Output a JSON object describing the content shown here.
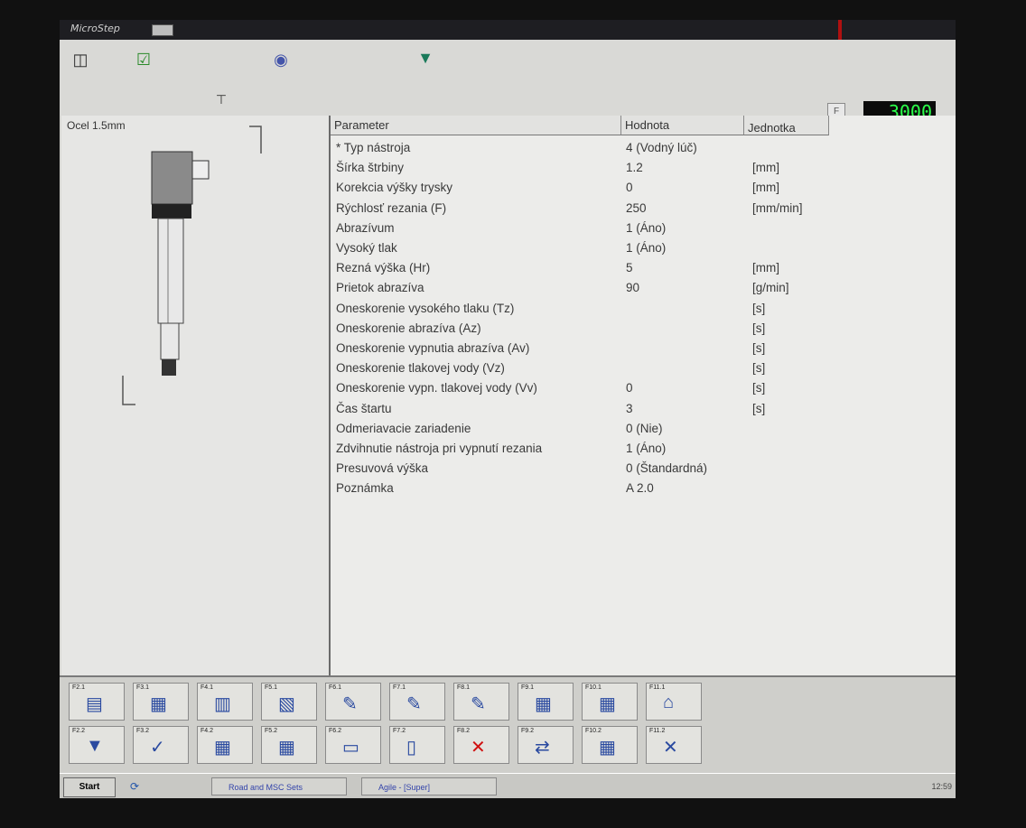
{
  "window": {
    "app_name": "MicroStep"
  },
  "status": {
    "feed_label": "F",
    "feed_value": "3000"
  },
  "left_panel": {
    "material": "Ocel 1.5mm"
  },
  "table": {
    "headers": {
      "parameter": "Parameter",
      "value": "Hodnota",
      "unit": "Jednotka"
    },
    "rows": [
      {
        "parameter": "* Typ nástroja",
        "value": "4 (Vodný lúč)",
        "unit": ""
      },
      {
        "parameter": "Šírka štrbiny",
        "value": "1.2",
        "unit": "[mm]"
      },
      {
        "parameter": "Korekcia výšky trysky",
        "value": "0",
        "unit": "[mm]"
      },
      {
        "parameter": "Rýchlosť rezania (F)",
        "value": "250",
        "unit": "[mm/min]"
      },
      {
        "parameter": "Abrazívum",
        "value": "1 (Áno)",
        "unit": ""
      },
      {
        "parameter": "Vysoký tlak",
        "value": "1 (Áno)",
        "unit": ""
      },
      {
        "parameter": "Rezná výška (Hr)",
        "value": "5",
        "unit": "[mm]"
      },
      {
        "parameter": "Prietok abrazíva",
        "value": "90",
        "unit": "[g/min]"
      },
      {
        "parameter": "Oneskorenie vysokého tlaku (Tz)",
        "value": "",
        "unit": "[s]"
      },
      {
        "parameter": "Oneskorenie abrazíva (Az)",
        "value": "",
        "unit": "[s]"
      },
      {
        "parameter": "Oneskorenie vypnutia abrazíva (Av)",
        "value": "",
        "unit": "[s]"
      },
      {
        "parameter": "Oneskorenie tlakovej vody (Vz)",
        "value": "",
        "unit": "[s]"
      },
      {
        "parameter": "Oneskorenie vypn. tlakovej vody (Vv)",
        "value": "0",
        "unit": "[s]"
      },
      {
        "parameter": "Čas štartu",
        "value": "3",
        "unit": "[s]"
      },
      {
        "parameter": "Odmeriavacie zariadenie",
        "value": "0 (Nie)",
        "unit": ""
      },
      {
        "parameter": "Zdvihnutie nástroja pri vypnutí rezania",
        "value": "1 (Áno)",
        "unit": ""
      },
      {
        "parameter": "Presuvová výška",
        "value": "0 (Štandardná)",
        "unit": ""
      },
      {
        "parameter": "Poznámka",
        "value": "A 2.0",
        "unit": ""
      }
    ]
  },
  "function_buttons": {
    "row1": [
      "F2.1",
      "F3.1",
      "F4.1",
      "F5.1",
      "F6.1",
      "F7.1",
      "F8.1",
      "F9.1",
      "F10.1",
      "F11.1"
    ],
    "row2": [
      "F2.2",
      "F3.2",
      "F4.2",
      "F5.2",
      "F6.2",
      "F7.2",
      "F8.2",
      "F9.2",
      "F10.2",
      "F11.2"
    ]
  },
  "taskbar": {
    "start": "Start",
    "task1": "Road and MSC Sets",
    "task2": "Agile - [Super]",
    "clock": "12:59"
  },
  "colors": {
    "feed_display": "#2cff4a",
    "screen_bg": "#d7d7d3"
  }
}
